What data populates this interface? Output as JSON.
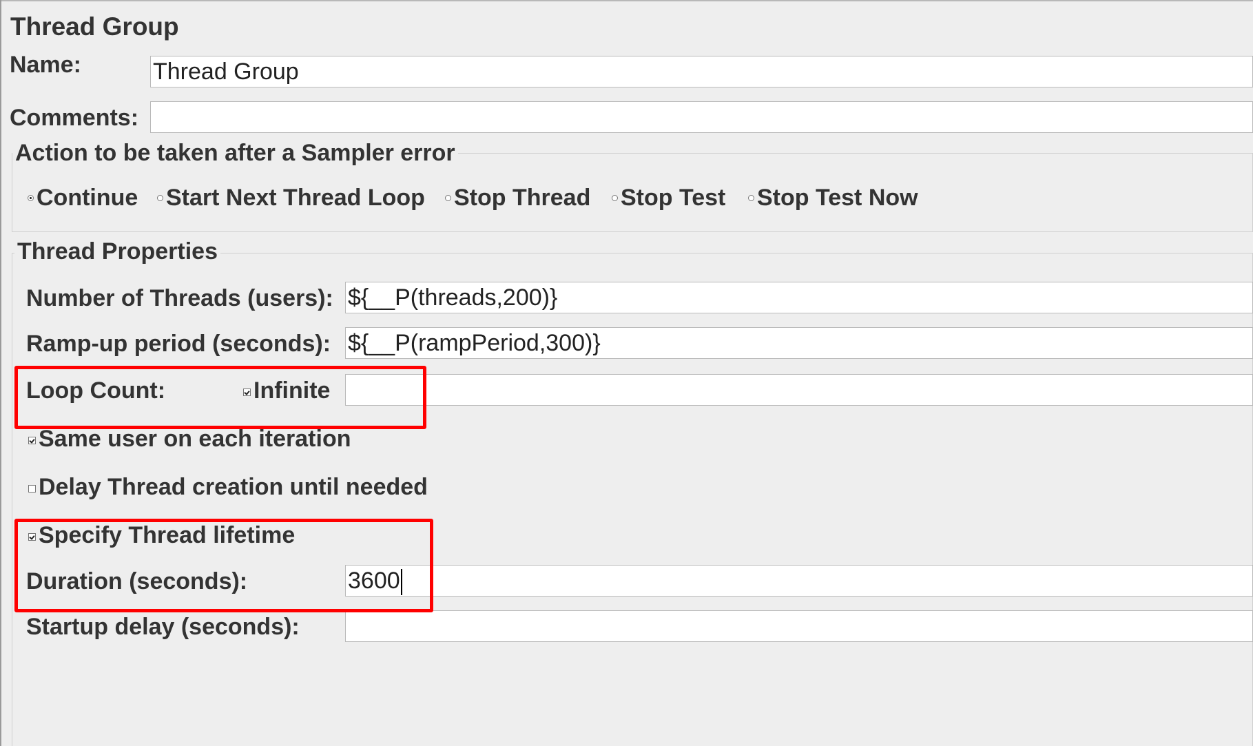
{
  "panel": {
    "title": "Thread Group"
  },
  "name_row": {
    "label": "Name:",
    "value": "Thread Group"
  },
  "comments_row": {
    "label": "Comments:",
    "value": ""
  },
  "sampler_error": {
    "legend": "Action to be taken after a Sampler error",
    "options": [
      {
        "label": "Continue",
        "selected": true
      },
      {
        "label": "Start Next Thread Loop",
        "selected": false
      },
      {
        "label": "Stop Thread",
        "selected": false
      },
      {
        "label": "Stop Test",
        "selected": false
      },
      {
        "label": "Stop Test Now",
        "selected": false
      }
    ]
  },
  "thread_properties": {
    "legend": "Thread Properties",
    "num_threads": {
      "label": "Number of Threads (users):",
      "value": "${__P(threads,200)}"
    },
    "ramp_up": {
      "label": "Ramp-up period (seconds):",
      "value": "${__P(rampPeriod,300)}"
    },
    "loop_count": {
      "label": "Loop Count:",
      "infinite_label": "Infinite",
      "infinite_checked": true,
      "value": ""
    },
    "same_user": {
      "label": "Same user on each iteration",
      "checked": true
    },
    "delay_creation": {
      "label": "Delay Thread creation until needed",
      "checked": false
    },
    "specify_lifetime": {
      "label": "Specify Thread lifetime",
      "checked": true
    },
    "duration": {
      "label": "Duration (seconds):",
      "value": "3600"
    },
    "startup_delay": {
      "label": "Startup delay (seconds):",
      "value": ""
    }
  },
  "colors": {
    "background": "#eeeeee",
    "highlight": "#ff0000",
    "field_bg": "#ffffff"
  }
}
